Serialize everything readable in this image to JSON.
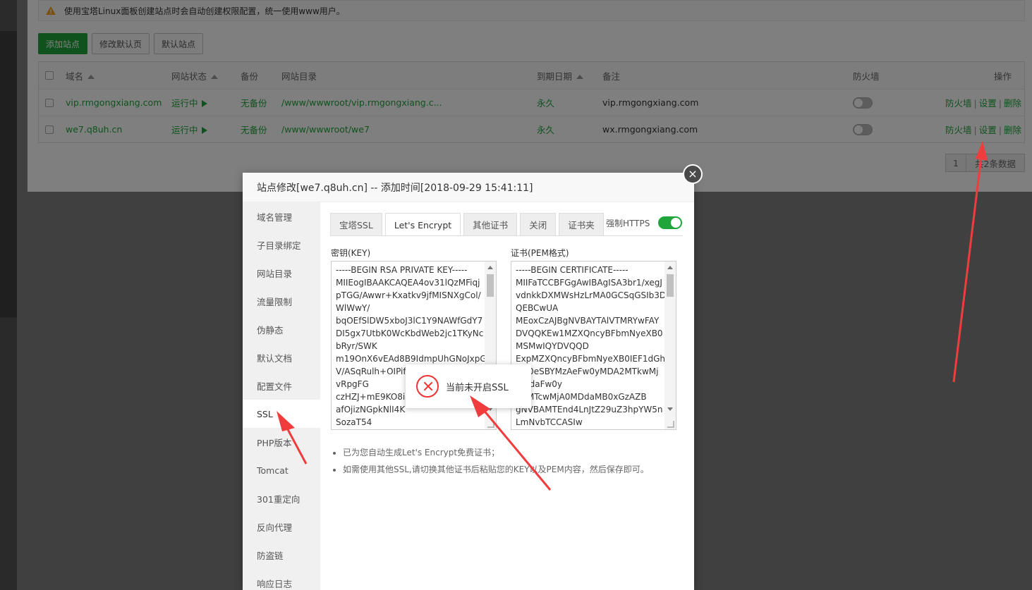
{
  "notice": {
    "text": "使用宝塔Linux面板创建站点时会自动创建权限配置，统一使用www用户。"
  },
  "toolbar": {
    "add_site": "添加站点",
    "edit_default_page": "修改默认页",
    "default_site": "默认站点"
  },
  "table": {
    "headers": {
      "domain": "域名",
      "status": "网站状态",
      "backup": "备份",
      "root": "网站目录",
      "expire": "到期日期",
      "remark": "备注",
      "firewall": "防火墙",
      "actions": "操作"
    },
    "rows": [
      {
        "domain": "vip.rmgongxiang.com",
        "status": "运行中",
        "backup": "无备份",
        "root": "/www/wwwroot/vip.rmgongxiang.c...",
        "expire": "永久",
        "remark": "vip.rmgongxiang.com",
        "firewall_on": false,
        "act_firewall": "防火墙",
        "act_settings": "设置",
        "act_delete": "删除"
      },
      {
        "domain": "we7.q8uh.cn",
        "status": "运行中",
        "backup": "无备份",
        "root": "/www/wwwroot/we7",
        "expire": "永久",
        "remark": "wx.rmgongxiang.com",
        "firewall_on": false,
        "act_firewall": "防火墙",
        "act_settings": "设置",
        "act_delete": "删除"
      }
    ],
    "separator": "|"
  },
  "pager": {
    "page": "1",
    "summary": "共2条数据"
  },
  "dialog": {
    "title": "站点修改[we7.q8uh.cn] -- 添加时间[2018-09-29 15:41:11]",
    "close_glyph": "×",
    "menu": [
      "域名管理",
      "子目录绑定",
      "网站目录",
      "流量限制",
      "伪静态",
      "默认文档",
      "配置文件",
      "SSL",
      "PHP版本",
      "Tomcat",
      "301重定向",
      "反向代理",
      "防盗链",
      "响应日志"
    ],
    "active_menu": "SSL",
    "tabs": [
      "宝塔SSL",
      "Let's Encrypt",
      "其他证书",
      "关闭",
      "证书夹"
    ],
    "active_tab": "Let's Encrypt",
    "force_https_label": "强制HTTPS",
    "force_https_on": true,
    "key_label": "密钥(KEY)",
    "cert_label": "证书(PEM格式)",
    "key_text": "-----BEGIN RSA PRIVATE KEY-----\nMIIEogIBAAKCAQEA4ov31lQzMFiqj\npTGG/Awwr+Kxatkv9jfMISNXgCol/\nWlWwY/\nbqOEfSlDW5xboJ3lC1Y9NAWfGdY7\nDI5gx7UtbK0WcKbdWeb2jc1TKyNc\nbRyr/SWK\nm19OnX6vEAd8B9IdmpUhGNoJxpG\nV/ASqRulh+OIPif\nvRpgFG\nczHZJ+mE9KO8iD\nafOjizNGpkNlI4K\nSozaT54",
    "cert_text": "-----BEGIN CERTIFICATE-----\nMIIFaTCCBFGgAwIBAgISA3br1/xegJ\nvdnkkDXMWsHzLrMA0GCSqGSIb3D\nQEBCwUA\nMEoxCzAJBgNVBAYTAlVTMRYwFAY\nDVQQKEw1MZXQncyBFbmNyeXB0\nMSMwIQYDVQQD\nExpMZXQncyBFbmNyeXB0IEF1dGhv\nIFg0eSBYMzAeFw0yMDA2MTkwMj\nMDdaFw0y\nA5MTcwMjA0MDdaMB0xGzAZB\ngNVBAMTEnd4LnJtZ29uZ3hpYW5n\nLmNvbTCCASIw",
    "tips": [
      "已为您自动生成Let's Encrypt免费证书；",
      "如需使用其他SSL,请切换其他证书后粘贴您的KEY以及PEM内容，然后保存即可。"
    ]
  },
  "toast": {
    "message": "当前未开启SSL",
    "icon": "error-x-icon"
  },
  "colors": {
    "accent": "#20a53a",
    "danger": "#ee3333",
    "annotation_arrow": "#f03c3c"
  }
}
